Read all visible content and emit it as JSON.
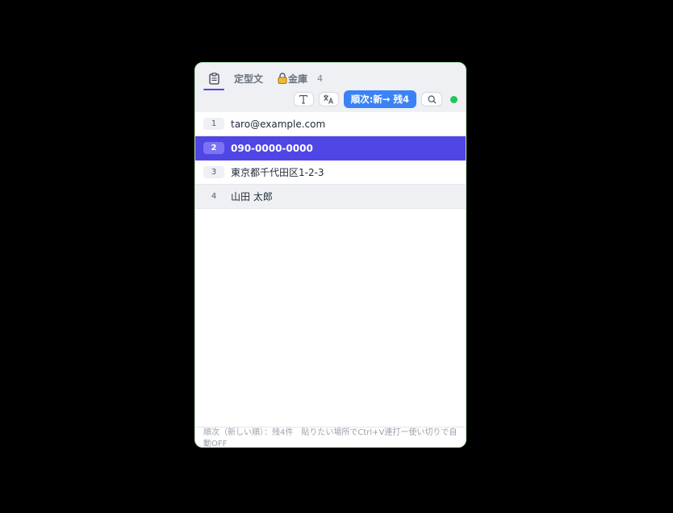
{
  "tabs": {
    "clipboard_icon": "clipboard-icon",
    "templates_label": "定型文",
    "vault_icon": "lock-icon",
    "vault_label": "金庫",
    "vault_count": "4"
  },
  "toolbar": {
    "text_icon": "text-format-icon",
    "translate_icon": "translate-icon",
    "order_label": "順次:新→ 残4",
    "search_icon": "search-icon",
    "status_color": "#22c55e"
  },
  "items": [
    {
      "num": "1",
      "text": "taro@example.com"
    },
    {
      "num": "2",
      "text": "090-0000-0000"
    },
    {
      "num": "3",
      "text": "東京都千代田区1-2-3"
    },
    {
      "num": "4",
      "text": "山田 太郎"
    }
  ],
  "footer": {
    "text": "順次（新しい順）：残4件　貼りたい場所でCtrl+V連打ー使い切りで自動OFF"
  },
  "colors": {
    "accent": "#5046e5",
    "order_button": "#3b82f6"
  }
}
